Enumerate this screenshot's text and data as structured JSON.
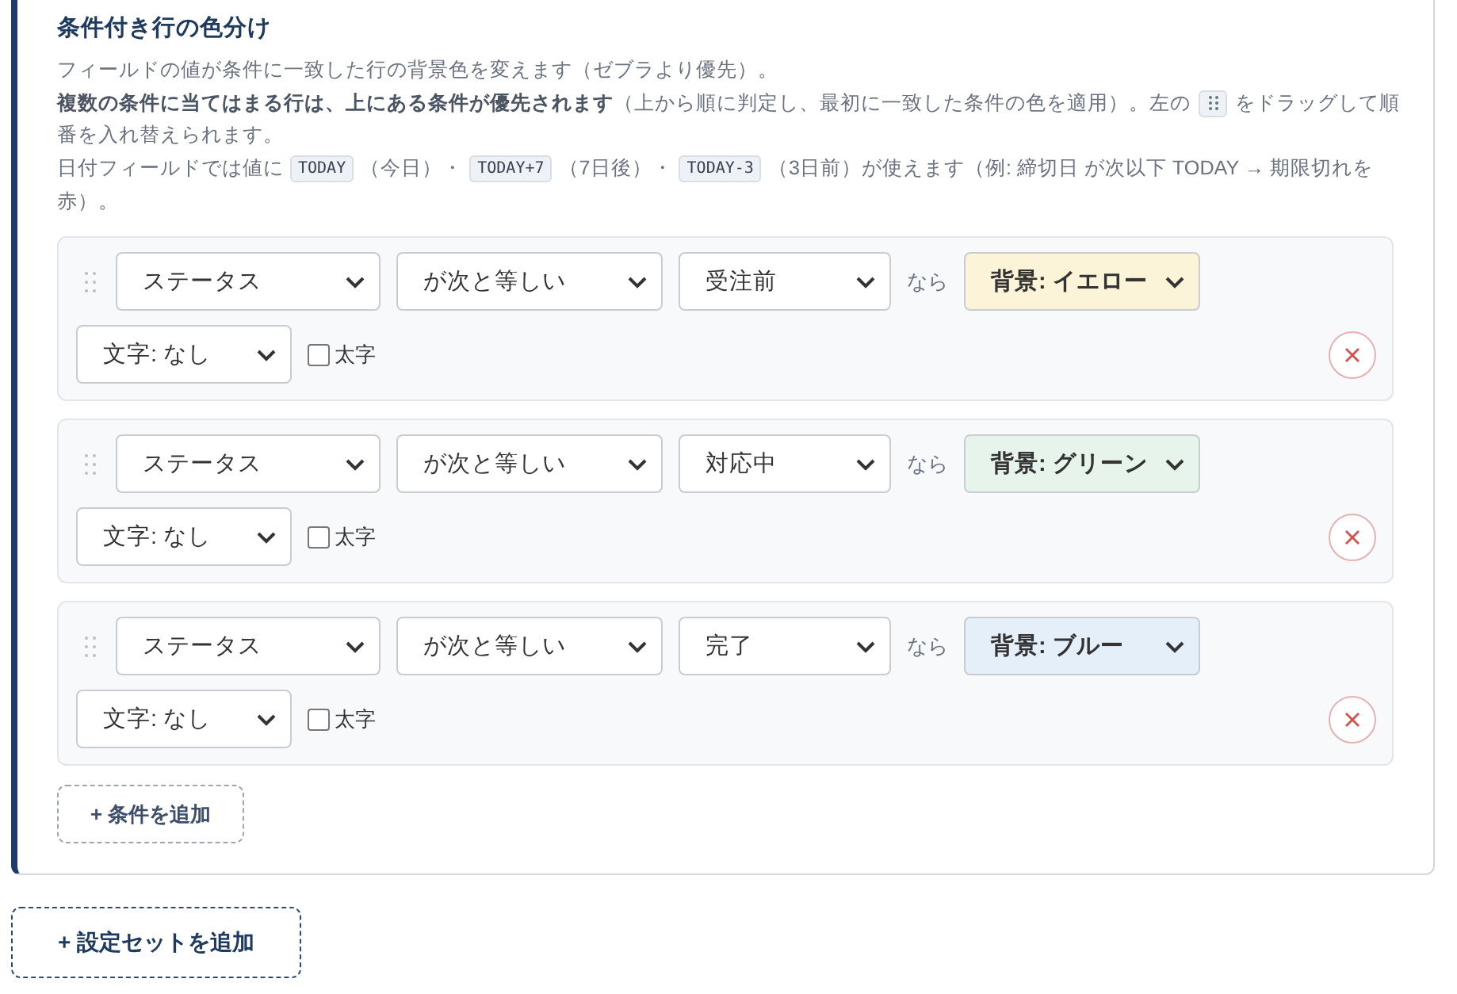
{
  "section": {
    "title": "条件付き行の色分け",
    "description": [
      [
        {
          "kind": "text",
          "text": "フィールドの値が条件に一致した行の背景色を変えます（ゼブラより優先）。"
        }
      ],
      [
        {
          "kind": "text",
          "text": "**複数の条件に当てはまる行は、上にある条件が優先されます**（上から順に判定し、最初に一致した条件の色を適用）。左の"
        },
        {
          "kind": "icon"
        },
        {
          "kind": "text",
          "text": "をドラッグして順"
        }
      ],
      [
        {
          "kind": "text",
          "text": "番を入れ替えられます。"
        }
      ],
      [
        {
          "kind": "text",
          "text": "日付フィールドでは値に"
        },
        {
          "kind": "code",
          "text": "TODAY"
        },
        {
          "kind": "text",
          "text": "（今日）・"
        },
        {
          "kind": "code",
          "text": "TODAY+7"
        },
        {
          "kind": "text",
          "text": "（7日後）・"
        },
        {
          "kind": "code",
          "text": "TODAY-3"
        },
        {
          "kind": "text",
          "text": "（3日前）が使えます（例: 締切日 が次以下 TODAY → 期限切れを"
        }
      ],
      [
        {
          "kind": "text",
          "text": "赤）。"
        }
      ]
    ],
    "rules": [
      {
        "field": "ステータス",
        "operator": "が次と等しい",
        "value": "受注前",
        "connector": "なら",
        "background": {
          "label": "背景: イエロー",
          "color": "#fbf4d8"
        },
        "text_color": "文字: なし",
        "bold": {
          "label": "太字",
          "checked": false
        }
      },
      {
        "field": "ステータス",
        "operator": "が次と等しい",
        "value": "対応中",
        "connector": "なら",
        "background": {
          "label": "背景: グリーン",
          "color": "#e7f4ec"
        },
        "text_color": "文字: なし",
        "bold": {
          "label": "太字",
          "checked": false
        }
      },
      {
        "field": "ステータス",
        "operator": "が次と等しい",
        "value": "完了",
        "connector": "なら",
        "background": {
          "label": "背景: ブルー",
          "color": "#e5effa"
        },
        "text_color": "文字: なし",
        "bold": {
          "label": "太字",
          "checked": false
        }
      }
    ],
    "add_condition_button": "+ 条件を追加"
  },
  "add_set_button": "+ 設定セットを追加"
}
